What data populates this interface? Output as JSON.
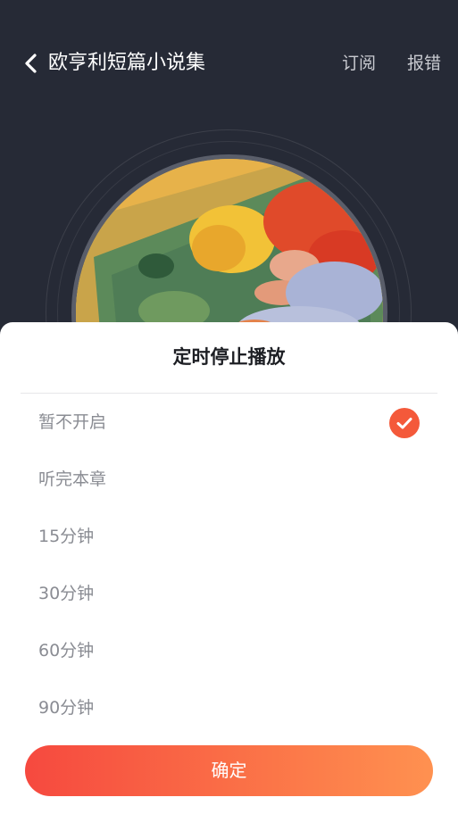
{
  "header": {
    "title": "欧亨利短篇小说集",
    "subscribe_label": "订阅",
    "report_label": "报错"
  },
  "icons": {
    "back": "chevron-left-icon",
    "selected": "check-icon"
  },
  "sheet": {
    "title": "定时停止播放",
    "options": [
      {
        "label": "暂不开启",
        "selected": true
      },
      {
        "label": "听完本章",
        "selected": false
      },
      {
        "label": "15分钟",
        "selected": false
      },
      {
        "label": "30分钟",
        "selected": false
      },
      {
        "label": "60分钟",
        "selected": false
      },
      {
        "label": "90分钟",
        "selected": false
      }
    ],
    "confirm_label": "确定"
  },
  "colors": {
    "background": "#262a36",
    "accent": "#f4593a",
    "button_gradient_start": "#f6493f",
    "button_gradient_end": "#ff9150"
  }
}
